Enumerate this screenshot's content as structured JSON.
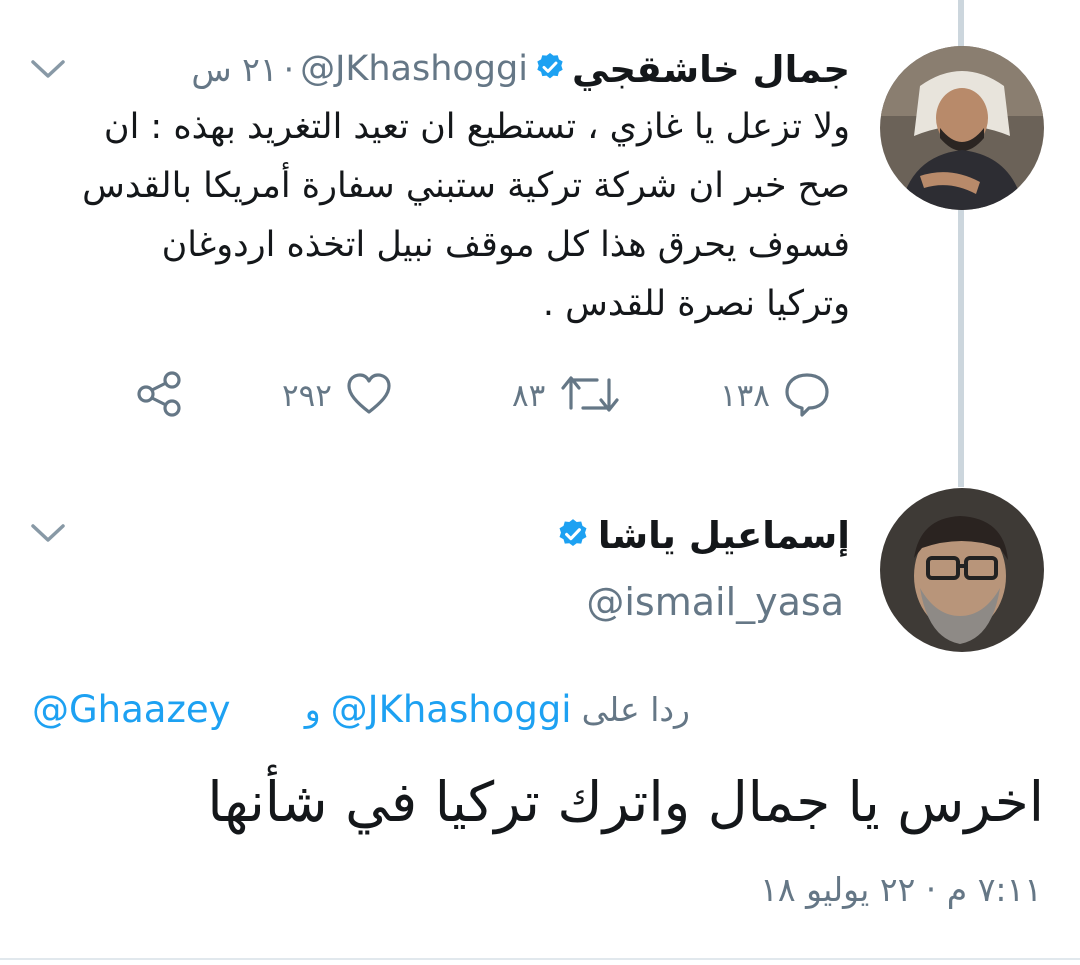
{
  "colors": {
    "accent": "#1da1f2",
    "secondary_text": "#657786",
    "thread_line": "#ccd6dd"
  },
  "tweet": {
    "name": "جمال خاشقجي",
    "verified_icon": "verified-badge-icon",
    "handle": "@JKhashoggi",
    "separator": "·",
    "time": "٢١ س",
    "menu_icon": "chevron-down-icon",
    "text": "ولا تزعل يا غازي ، تستطيع ان تعيد التغريد بهذه : ان صح خبر ان شركة تركية ستبني سفارة أمريكا بالقدس فسوف يحرق هذا كل موقف نبيل اتخذه اردوغان وتركيا نصرة للقدس .",
    "actions": {
      "reply": {
        "icon": "reply-bubble-icon",
        "count": "١٣٨"
      },
      "retweet": {
        "icon": "retweet-icon",
        "count": "٨٣"
      },
      "like": {
        "icon": "heart-icon",
        "count": "٢٩٢"
      },
      "share": {
        "icon": "share-icon"
      }
    }
  },
  "reply": {
    "name": "إسماعيل ياشا",
    "verified_icon": "verified-badge-icon",
    "handle": "@ismail_yasa",
    "menu_icon": "chevron-down-icon",
    "replying_label": "ردا على",
    "replying_handle_1": "@JKhashoggi",
    "replying_and": "و",
    "replying_handle_2": "@Ghaazey",
    "text": "اخرس يا جمال واترك تركيا في شأنها",
    "timestamp": "٧:١١ م · ٢٢ يوليو ١٨"
  }
}
